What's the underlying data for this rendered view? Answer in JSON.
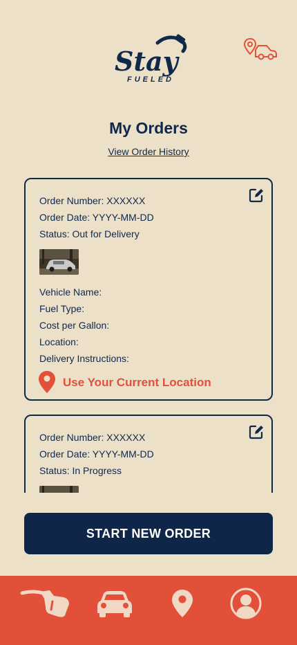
{
  "brand": {
    "logo_word": "Stay",
    "logo_sub": "FUELED"
  },
  "page": {
    "title": "My Orders",
    "history_link": "View Order History"
  },
  "orders": [
    {
      "number_line": "Order Number: XXXXXX",
      "date_line": "Order Date: YYYY-MM-DD",
      "status_line": "Status: Out for Delivery",
      "vehicle_name": "Vehicle Name:",
      "fuel_type": "Fuel Type:",
      "cost": "Cost per Gallon:",
      "location": "Location:",
      "instructions": "Delivery Instructions:",
      "use_location": "Use Your Current Location"
    },
    {
      "number_line": "Order Number: XXXXXX",
      "date_line": "Order Date: YYYY-MM-DD",
      "status_line": "Status: In Progress"
    }
  ],
  "actions": {
    "start_new_order": "START NEW ORDER"
  },
  "nav": [
    "fuel-pump-icon",
    "car-icon",
    "location-pin-icon",
    "profile-icon"
  ],
  "colors": {
    "background": "#ece0c8",
    "navy": "#10284a",
    "accent": "#e2503a"
  }
}
